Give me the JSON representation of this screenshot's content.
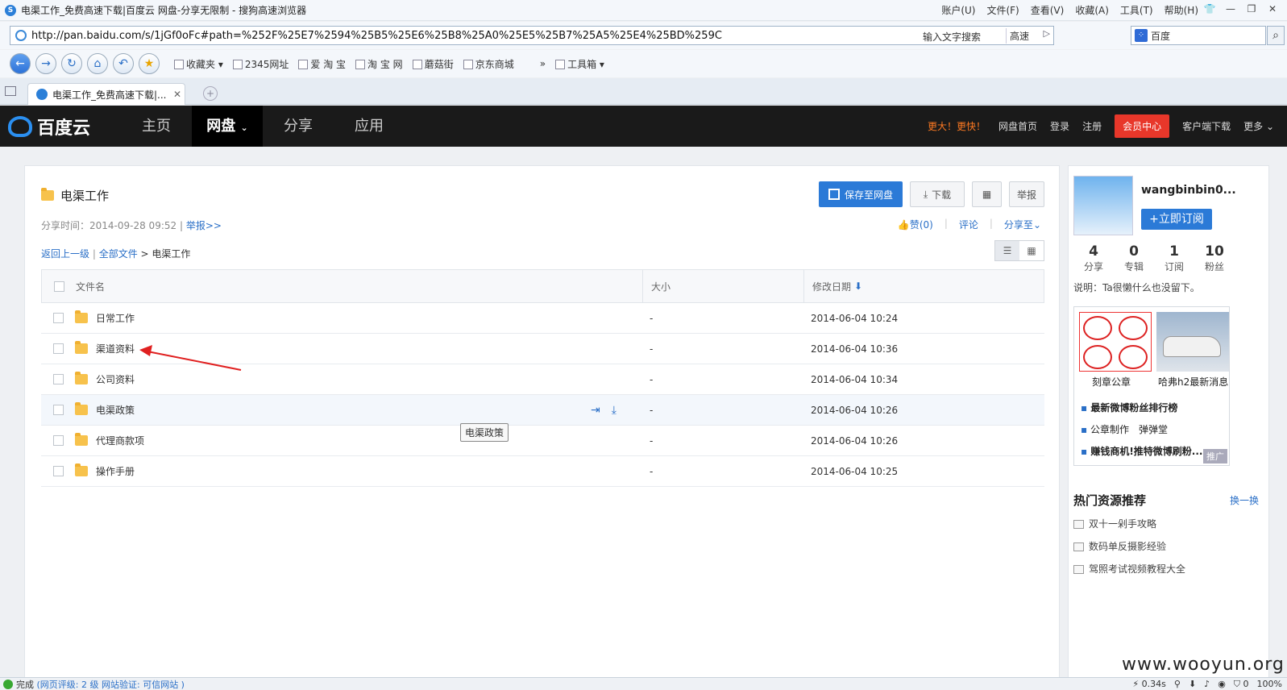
{
  "browser": {
    "window_title": "电渠工作_免费高速下载|百度云 网盘-分享无限制 - 搜狗高速浏览器",
    "menus": [
      "账户(U)",
      "文件(F)",
      "查看(V)",
      "收藏(A)",
      "工具(T)",
      "帮助(H)"
    ],
    "url": "http://pan.baidu.com/s/1jGf0oFc#path=%252F%25E7%2594%25B5%25E6%25B8%25A0%25E5%25B7%25A5%25E4%25BD%259C",
    "addr_hint": "输入文字搜索",
    "speed_label": "高速",
    "search_value": "百度",
    "favorites": [
      "收藏夹",
      "2345网址",
      "爱 淘 宝",
      "淘 宝 网",
      "蘑菇街",
      "京东商城"
    ],
    "toolbox_label": "工具箱",
    "tab_title": "电渠工作_免费高速下载|..."
  },
  "header": {
    "brand": "百度云",
    "nav": [
      "主页",
      "网盘",
      "分享",
      "应用"
    ],
    "promo": "更大！更快！",
    "links": [
      "网盘首页",
      "登录",
      "注册"
    ],
    "vip": "会员中心",
    "client": "客户端下载",
    "more": "更多"
  },
  "main": {
    "folder_title": "电渠工作",
    "share_time": "分享时间：2014-09-28 09:52",
    "report_link": "举报>>",
    "save_button": "保存至网盘",
    "download_button": "下载",
    "report_button": "举报",
    "likes": "赞(0)",
    "comment": "评论",
    "share_to": "分享至",
    "crumb_back": "返回上一级",
    "crumb_all": "全部文件",
    "crumb_current": "> 电渠工作",
    "columns": [
      "文件名",
      "大小",
      "修改日期"
    ],
    "rows": [
      {
        "name": "日常工作",
        "size": "-",
        "date": "2014-06-04 10:24"
      },
      {
        "name": "渠道资料",
        "size": "-",
        "date": "2014-06-04 10:36"
      },
      {
        "name": "公司资料",
        "size": "-",
        "date": "2014-06-04 10:34"
      },
      {
        "name": "电渠政策",
        "size": "-",
        "date": "2014-06-04 10:26"
      },
      {
        "name": "代理商款项",
        "size": "-",
        "date": "2014-06-04 10:26"
      },
      {
        "name": "操作手册",
        "size": "-",
        "date": "2014-06-04 10:25"
      }
    ],
    "tooltip": "电渠政策"
  },
  "sidebar": {
    "username": "wangbinbin0...",
    "subscribe": "立即订阅",
    "stats": [
      {
        "value": "4",
        "label": "分享"
      },
      {
        "value": "0",
        "label": "专辑"
      },
      {
        "value": "1",
        "label": "订阅"
      },
      {
        "value": "10",
        "label": "粉丝"
      }
    ],
    "description": "说明：Ta很懒什么也没留下。",
    "ad_captions": [
      "刻章公章",
      "哈弗h2最新消息"
    ],
    "ad_items": [
      "最新微博粉丝排行榜",
      "公章制作　弹弹堂",
      "赚钱商机!推特微博刷粉..."
    ],
    "ad_tag": "推广",
    "hot_title": "热门资源推荐",
    "hot_switch": "换一换",
    "hot_items": [
      "双十一剁手攻略",
      "数码单反摄影经验",
      "驾照考试视频教程大全"
    ]
  },
  "statusbar": {
    "done": "完成",
    "rating": "(网页评级: 2 级 网站验证: 可信网站 )",
    "timing": "0.34s",
    "count": "0",
    "zoom": "100%"
  },
  "watermark": "www.wooyun.org"
}
